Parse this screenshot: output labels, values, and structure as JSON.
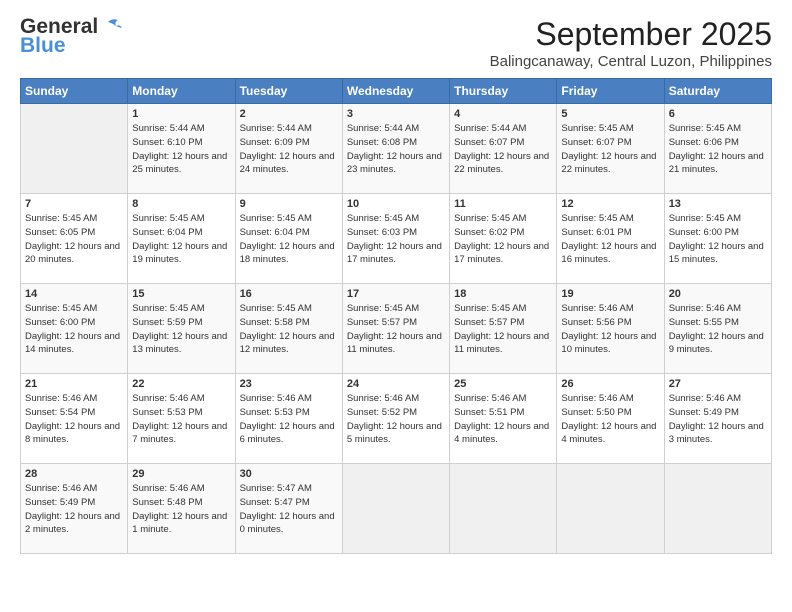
{
  "header": {
    "logo_line1": "General",
    "logo_line2": "Blue",
    "month": "September 2025",
    "location": "Balingcanaway, Central Luzon, Philippines"
  },
  "days_of_week": [
    "Sunday",
    "Monday",
    "Tuesday",
    "Wednesday",
    "Thursday",
    "Friday",
    "Saturday"
  ],
  "weeks": [
    [
      {
        "day": "",
        "sunrise": "",
        "sunset": "",
        "daylight": ""
      },
      {
        "day": "1",
        "sunrise": "Sunrise: 5:44 AM",
        "sunset": "Sunset: 6:10 PM",
        "daylight": "Daylight: 12 hours and 25 minutes."
      },
      {
        "day": "2",
        "sunrise": "Sunrise: 5:44 AM",
        "sunset": "Sunset: 6:09 PM",
        "daylight": "Daylight: 12 hours and 24 minutes."
      },
      {
        "day": "3",
        "sunrise": "Sunrise: 5:44 AM",
        "sunset": "Sunset: 6:08 PM",
        "daylight": "Daylight: 12 hours and 23 minutes."
      },
      {
        "day": "4",
        "sunrise": "Sunrise: 5:44 AM",
        "sunset": "Sunset: 6:07 PM",
        "daylight": "Daylight: 12 hours and 22 minutes."
      },
      {
        "day": "5",
        "sunrise": "Sunrise: 5:45 AM",
        "sunset": "Sunset: 6:07 PM",
        "daylight": "Daylight: 12 hours and 22 minutes."
      },
      {
        "day": "6",
        "sunrise": "Sunrise: 5:45 AM",
        "sunset": "Sunset: 6:06 PM",
        "daylight": "Daylight: 12 hours and 21 minutes."
      }
    ],
    [
      {
        "day": "7",
        "sunrise": "Sunrise: 5:45 AM",
        "sunset": "Sunset: 6:05 PM",
        "daylight": "Daylight: 12 hours and 20 minutes."
      },
      {
        "day": "8",
        "sunrise": "Sunrise: 5:45 AM",
        "sunset": "Sunset: 6:04 PM",
        "daylight": "Daylight: 12 hours and 19 minutes."
      },
      {
        "day": "9",
        "sunrise": "Sunrise: 5:45 AM",
        "sunset": "Sunset: 6:04 PM",
        "daylight": "Daylight: 12 hours and 18 minutes."
      },
      {
        "day": "10",
        "sunrise": "Sunrise: 5:45 AM",
        "sunset": "Sunset: 6:03 PM",
        "daylight": "Daylight: 12 hours and 17 minutes."
      },
      {
        "day": "11",
        "sunrise": "Sunrise: 5:45 AM",
        "sunset": "Sunset: 6:02 PM",
        "daylight": "Daylight: 12 hours and 17 minutes."
      },
      {
        "day": "12",
        "sunrise": "Sunrise: 5:45 AM",
        "sunset": "Sunset: 6:01 PM",
        "daylight": "Daylight: 12 hours and 16 minutes."
      },
      {
        "day": "13",
        "sunrise": "Sunrise: 5:45 AM",
        "sunset": "Sunset: 6:00 PM",
        "daylight": "Daylight: 12 hours and 15 minutes."
      }
    ],
    [
      {
        "day": "14",
        "sunrise": "Sunrise: 5:45 AM",
        "sunset": "Sunset: 6:00 PM",
        "daylight": "Daylight: 12 hours and 14 minutes."
      },
      {
        "day": "15",
        "sunrise": "Sunrise: 5:45 AM",
        "sunset": "Sunset: 5:59 PM",
        "daylight": "Daylight: 12 hours and 13 minutes."
      },
      {
        "day": "16",
        "sunrise": "Sunrise: 5:45 AM",
        "sunset": "Sunset: 5:58 PM",
        "daylight": "Daylight: 12 hours and 12 minutes."
      },
      {
        "day": "17",
        "sunrise": "Sunrise: 5:45 AM",
        "sunset": "Sunset: 5:57 PM",
        "daylight": "Daylight: 12 hours and 11 minutes."
      },
      {
        "day": "18",
        "sunrise": "Sunrise: 5:45 AM",
        "sunset": "Sunset: 5:57 PM",
        "daylight": "Daylight: 12 hours and 11 minutes."
      },
      {
        "day": "19",
        "sunrise": "Sunrise: 5:46 AM",
        "sunset": "Sunset: 5:56 PM",
        "daylight": "Daylight: 12 hours and 10 minutes."
      },
      {
        "day": "20",
        "sunrise": "Sunrise: 5:46 AM",
        "sunset": "Sunset: 5:55 PM",
        "daylight": "Daylight: 12 hours and 9 minutes."
      }
    ],
    [
      {
        "day": "21",
        "sunrise": "Sunrise: 5:46 AM",
        "sunset": "Sunset: 5:54 PM",
        "daylight": "Daylight: 12 hours and 8 minutes."
      },
      {
        "day": "22",
        "sunrise": "Sunrise: 5:46 AM",
        "sunset": "Sunset: 5:53 PM",
        "daylight": "Daylight: 12 hours and 7 minutes."
      },
      {
        "day": "23",
        "sunrise": "Sunrise: 5:46 AM",
        "sunset": "Sunset: 5:53 PM",
        "daylight": "Daylight: 12 hours and 6 minutes."
      },
      {
        "day": "24",
        "sunrise": "Sunrise: 5:46 AM",
        "sunset": "Sunset: 5:52 PM",
        "daylight": "Daylight: 12 hours and 5 minutes."
      },
      {
        "day": "25",
        "sunrise": "Sunrise: 5:46 AM",
        "sunset": "Sunset: 5:51 PM",
        "daylight": "Daylight: 12 hours and 4 minutes."
      },
      {
        "day": "26",
        "sunrise": "Sunrise: 5:46 AM",
        "sunset": "Sunset: 5:50 PM",
        "daylight": "Daylight: 12 hours and 4 minutes."
      },
      {
        "day": "27",
        "sunrise": "Sunrise: 5:46 AM",
        "sunset": "Sunset: 5:49 PM",
        "daylight": "Daylight: 12 hours and 3 minutes."
      }
    ],
    [
      {
        "day": "28",
        "sunrise": "Sunrise: 5:46 AM",
        "sunset": "Sunset: 5:49 PM",
        "daylight": "Daylight: 12 hours and 2 minutes."
      },
      {
        "day": "29",
        "sunrise": "Sunrise: 5:46 AM",
        "sunset": "Sunset: 5:48 PM",
        "daylight": "Daylight: 12 hours and 1 minute."
      },
      {
        "day": "30",
        "sunrise": "Sunrise: 5:47 AM",
        "sunset": "Sunset: 5:47 PM",
        "daylight": "Daylight: 12 hours and 0 minutes."
      },
      {
        "day": "",
        "sunrise": "",
        "sunset": "",
        "daylight": ""
      },
      {
        "day": "",
        "sunrise": "",
        "sunset": "",
        "daylight": ""
      },
      {
        "day": "",
        "sunrise": "",
        "sunset": "",
        "daylight": ""
      },
      {
        "day": "",
        "sunrise": "",
        "sunset": "",
        "daylight": ""
      }
    ]
  ]
}
